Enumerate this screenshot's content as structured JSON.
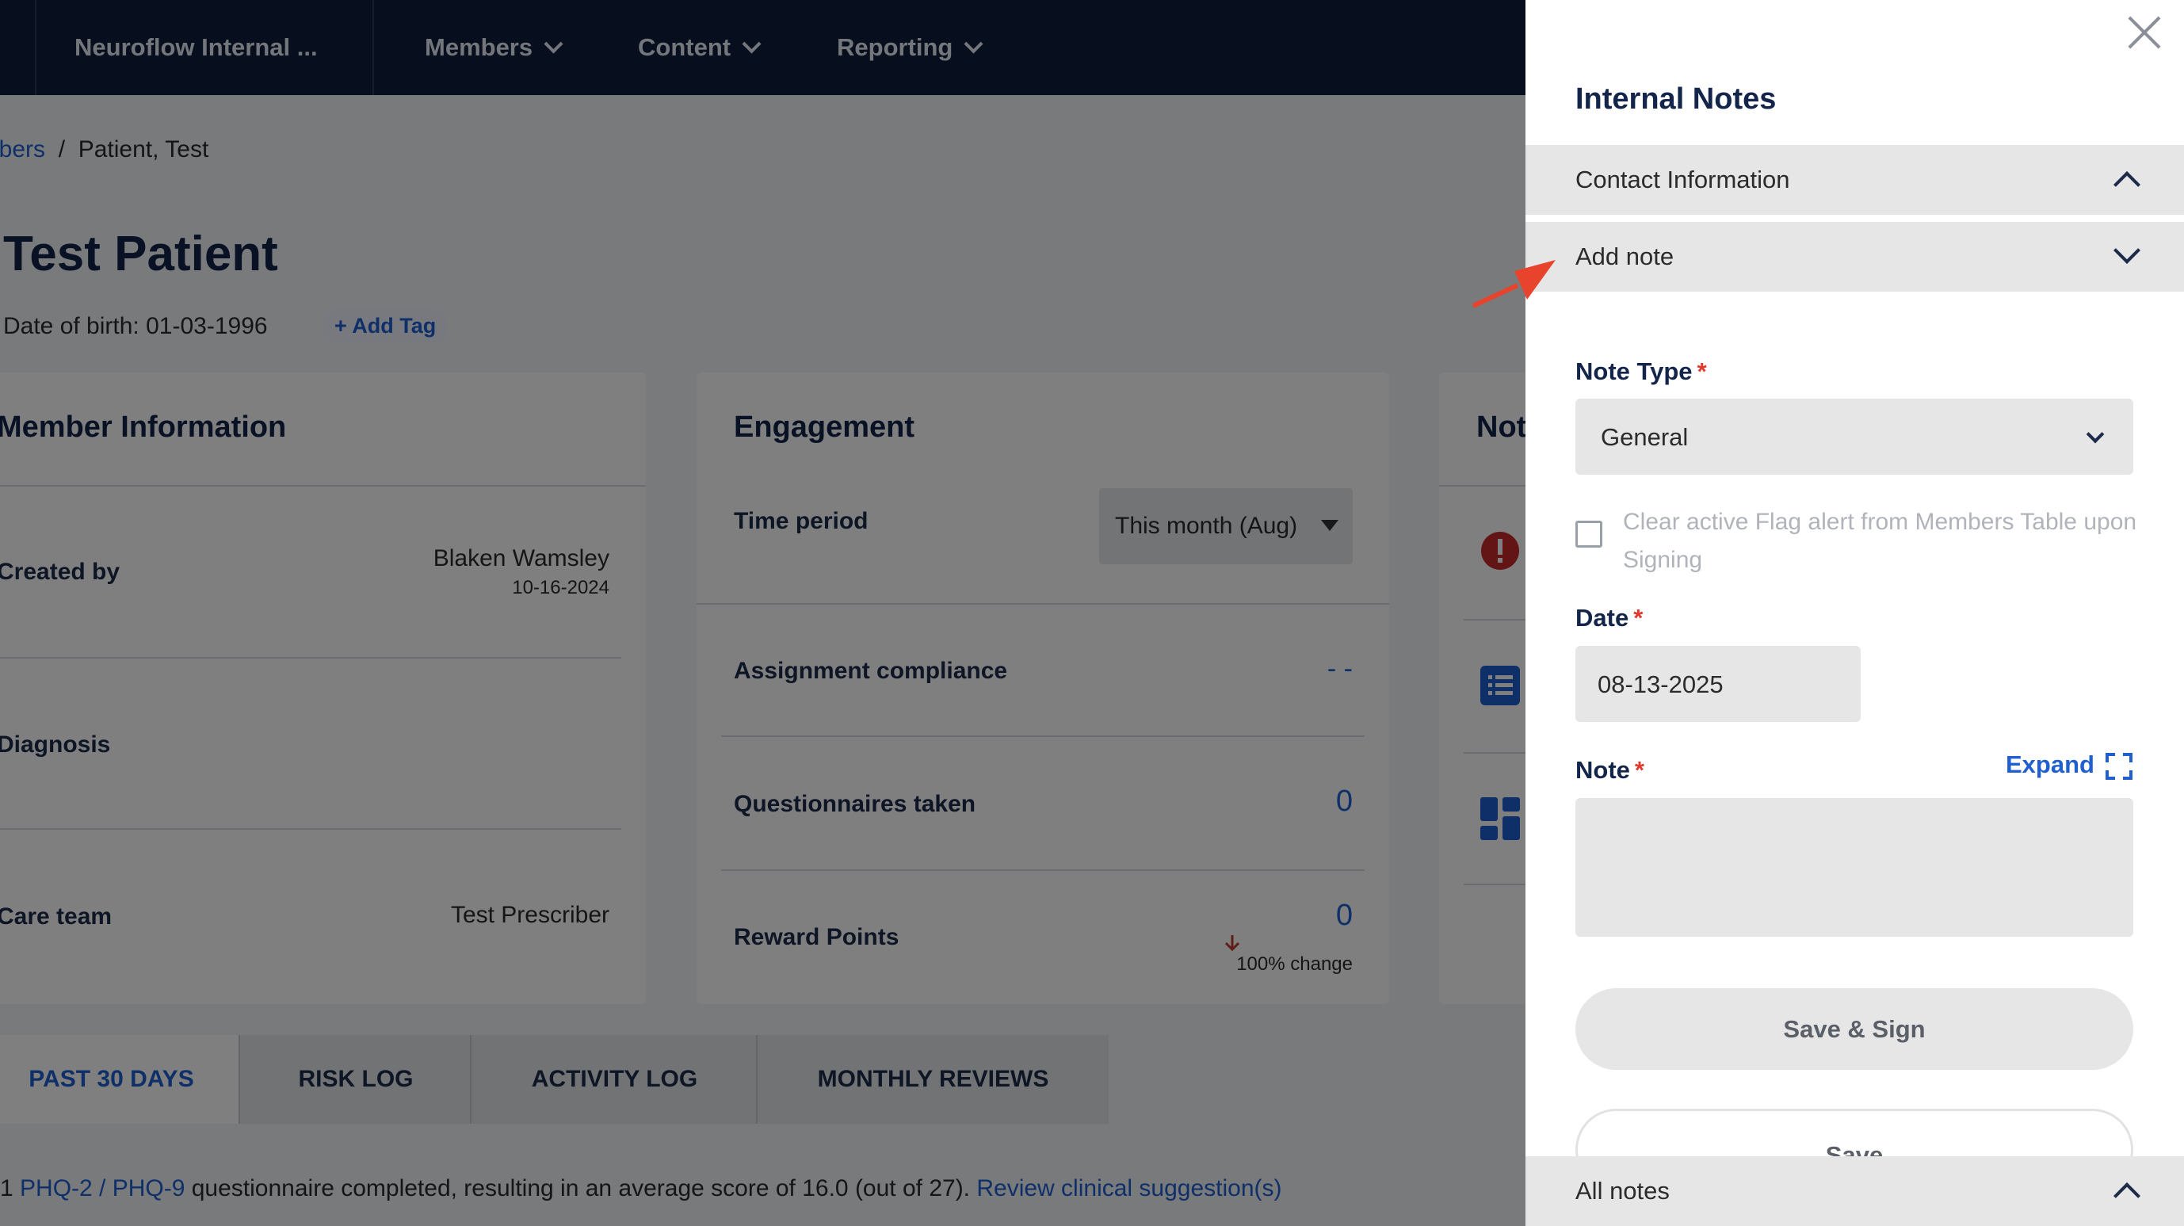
{
  "nav": {
    "org": "Neuroflow Internal ...",
    "items": [
      "Members",
      "Content",
      "Reporting"
    ]
  },
  "breadcrumb": {
    "parent": "Members",
    "current": "Patient, Test"
  },
  "patient": {
    "name": "Test Patient",
    "dob_label": "Date of birth:",
    "dob": "01-03-1996",
    "add_tag": "+ Add Tag"
  },
  "member_info": {
    "title": "Member Information",
    "created_by_label": "Created by",
    "created_by": "Blaken Wamsley",
    "created_date": "10-16-2024",
    "diagnosis_label": "Diagnosis",
    "care_team_label": "Care team",
    "care_team": "Test Prescriber"
  },
  "engagement": {
    "title": "Engagement",
    "time_period_label": "Time period",
    "time_period": "This month (Aug)",
    "compliance_label": "Assignment compliance",
    "compliance": "- -",
    "questionnaires_label": "Questionnaires taken",
    "questionnaires": "0",
    "reward_label": "Reward Points",
    "reward": "0",
    "reward_change": "100% change"
  },
  "notes_card": {
    "title_fragment": "Not"
  },
  "tabs": [
    "PAST 30 DAYS",
    "RISK LOG",
    "ACTIVITY LOG",
    "MONTHLY REVIEWS"
  ],
  "summary": {
    "count": "1",
    "link": "PHQ-2 / PHQ-9",
    "text": "questionnaire completed, resulting in an average score of 16.0 (out of 27).",
    "suggestion_link": "Review clinical suggestion(s)"
  },
  "panel": {
    "title": "Internal Notes",
    "contact_info": "Contact Information",
    "add_note": "Add note",
    "note_type_label": "Note Type",
    "note_type": "General",
    "clear_flag": "Clear active Flag alert from Members Table upon Signing",
    "date_label": "Date",
    "date": "08-13-2025",
    "note_label": "Note",
    "expand": "Expand",
    "save_sign": "Save & Sign",
    "save": "Save",
    "all_notes": "All notes",
    "required_mark": "*"
  },
  "colors": {
    "nav": "#0f1f3c",
    "accent": "#1f5fd0",
    "required": "#e0392e",
    "annotation_arrow": "#e8432c"
  }
}
